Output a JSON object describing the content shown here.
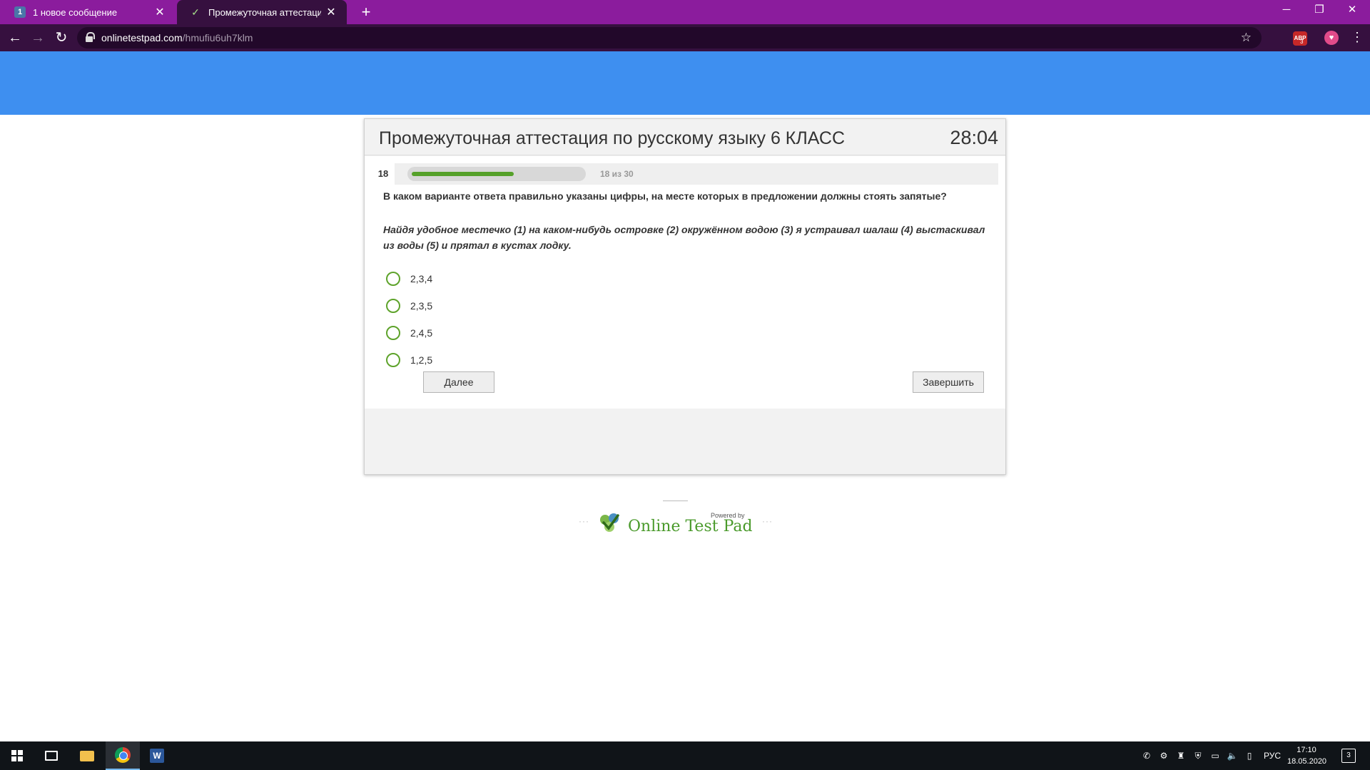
{
  "browser": {
    "tabs": [
      {
        "favicon": "1",
        "title": "1 новое сообщение",
        "active": false
      },
      {
        "favicon": "otp-logo-icon",
        "title": "Промежуточная аттестация по",
        "active": true
      }
    ],
    "url_domain": "onlinetestpad.com",
    "url_path": "/hmufiu6uh7klm",
    "extension_badge": "3",
    "extension_label": "ABP"
  },
  "test": {
    "title": "Промежуточная аттестация по русскому языку 6 КЛАСС",
    "timer": "28:04",
    "question_number": "18",
    "progress_text": "18 из 30",
    "progress": {
      "current": 18,
      "total": 30
    },
    "question": "В каком варианте ответа правильно указаны цифры, на месте которых в предложении должны стоять запятые?",
    "sentence": "Найдя удобное местечко (1) на каком-нибудь островке (2) окружённом водою (3) я устраивал шалаш (4) выстаскивал из воды (5) и прятал в кустах лодку.",
    "options": [
      "2,3,4",
      "2,3,5",
      "2,4,5",
      "1,2,5"
    ],
    "next_label": "Далее",
    "finish_label": "Завершить"
  },
  "footer": {
    "powered_by": "Powered by",
    "brand": "Online Test Pad"
  },
  "taskbar": {
    "language": "РУС",
    "time": "17:10",
    "date": "18.05.2020",
    "notifications": "3"
  },
  "colors": {
    "tabbar": "#8b1c9d",
    "toolbar": "#36103f",
    "header_band": "#3e8ff0",
    "progress_fill": "#56a12a",
    "radio_border": "#5ea32b"
  }
}
